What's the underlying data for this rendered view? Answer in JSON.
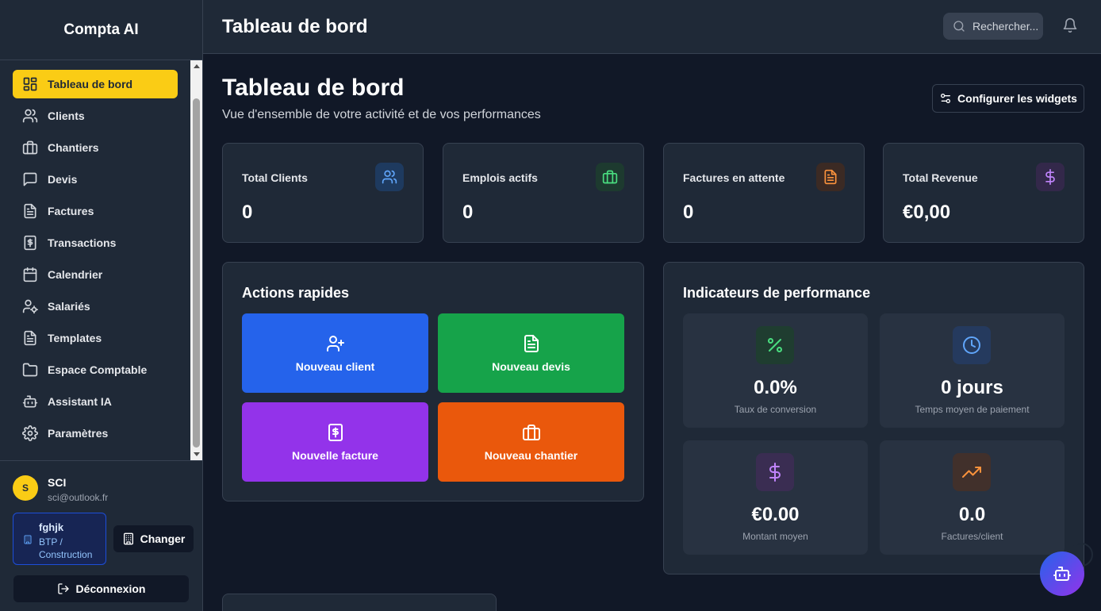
{
  "app": {
    "brand": "Compta AI"
  },
  "sidebar": {
    "items": [
      {
        "label": "Tableau de bord",
        "icon": "dashboard-icon",
        "active": true
      },
      {
        "label": "Clients",
        "icon": "users-icon"
      },
      {
        "label": "Chantiers",
        "icon": "briefcase-icon"
      },
      {
        "label": "Devis",
        "icon": "message-square-icon"
      },
      {
        "label": "Factures",
        "icon": "file-text-icon"
      },
      {
        "label": "Transactions",
        "icon": "receipt-icon"
      },
      {
        "label": "Calendrier",
        "icon": "calendar-icon"
      },
      {
        "label": "Salariés",
        "icon": "user-cog-icon"
      },
      {
        "label": "Templates",
        "icon": "file-text-icon"
      },
      {
        "label": "Espace Comptable",
        "icon": "folder-icon"
      },
      {
        "label": "Assistant IA",
        "icon": "bot-icon"
      },
      {
        "label": "Paramètres",
        "icon": "settings-icon"
      }
    ]
  },
  "user": {
    "initial": "S",
    "name": "SCI",
    "email": "sci@outlook.fr"
  },
  "company": {
    "name": "fghjk",
    "type": "BTP / Construction",
    "change_label": "Changer"
  },
  "logout_label": "Déconnexion",
  "header": {
    "title": "Tableau de bord",
    "search_placeholder": "Rechercher..."
  },
  "page": {
    "title": "Tableau de bord",
    "subtitle": "Vue d'ensemble de votre activité et de vos performances",
    "config_label": "Configurer les widgets"
  },
  "stats": [
    {
      "label": "Total Clients",
      "value": "0",
      "icon": "users-icon",
      "color": "#60a5fa"
    },
    {
      "label": "Emplois actifs",
      "value": "0",
      "icon": "briefcase-icon",
      "color": "#4ade80"
    },
    {
      "label": "Factures en attente",
      "value": "0",
      "icon": "file-text-icon",
      "color": "#fb923c"
    },
    {
      "label": "Total Revenue",
      "value": "€0,00",
      "icon": "dollar-icon",
      "color": "#c084fc"
    }
  ],
  "quick_actions": {
    "title": "Actions rapides",
    "items": [
      {
        "label": "Nouveau client",
        "icon": "user-plus-icon",
        "color": "#2563eb"
      },
      {
        "label": "Nouveau devis",
        "icon": "file-text-icon",
        "color": "#16a34a"
      },
      {
        "label": "Nouvelle facture",
        "icon": "receipt-icon",
        "color": "#9333ea"
      },
      {
        "label": "Nouveau chantier",
        "icon": "briefcase-icon",
        "color": "#ea580c"
      }
    ]
  },
  "performance": {
    "title": "Indicateurs de performance",
    "items": [
      {
        "value": "0.0%",
        "label": "Taux de conversion",
        "icon": "percent-icon",
        "color": "#4ade80"
      },
      {
        "value": "0 jours",
        "label": "Temps moyen de paiement",
        "icon": "clock-icon",
        "color": "#60a5fa"
      },
      {
        "value": "€0.00",
        "label": "Montant moyen",
        "icon": "dollar-icon",
        "color": "#c084fc"
      },
      {
        "value": "0.0",
        "label": "Factures/client",
        "icon": "trending-up-icon",
        "color": "#fb923c"
      }
    ]
  },
  "assistant_button": {
    "icon": "bot-icon"
  }
}
